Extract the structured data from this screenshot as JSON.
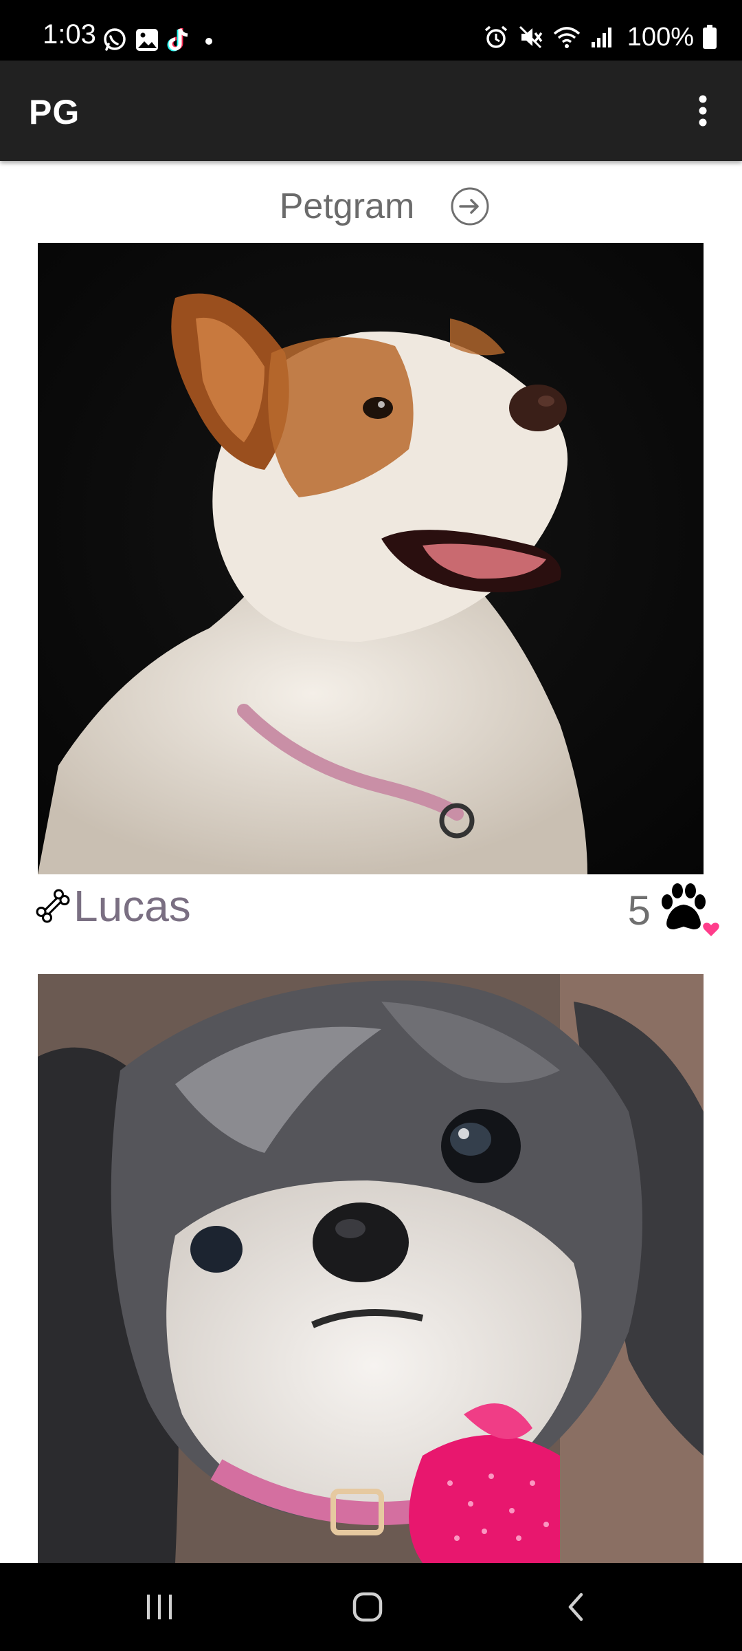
{
  "status_bar": {
    "time": "1:03",
    "battery": "100%",
    "left_icons": [
      "whatsapp-icon",
      "gallery-icon",
      "tiktok-icon",
      "dot-icon"
    ],
    "right_icons": [
      "alarm-icon",
      "mute-icon",
      "wifi-icon",
      "signal-icon",
      "battery-icon"
    ]
  },
  "app_bar": {
    "title": "PG",
    "overflow_icon": "more-vert-icon"
  },
  "feed": {
    "title": "Petgram",
    "action_icon": "arrow-circle-right-icon"
  },
  "posts": [
    {
      "owner": "Lucas",
      "likes": "5",
      "owner_icon": "bone-icon",
      "like_icon": "paw-heart-icon",
      "photo": "dog-photo-brown-white"
    },
    {
      "photo": "dog-photo-shih-tzu"
    }
  ],
  "nav_bar": {
    "buttons": [
      "recents-icon",
      "home-icon",
      "back-icon"
    ]
  },
  "colors": {
    "status_bar": "#000000",
    "app_bar": "#212121",
    "background": "#ffffff",
    "title_text": "#6b6b6b",
    "owner_text": "#7a6f82",
    "heart": "#ff3d8b"
  }
}
